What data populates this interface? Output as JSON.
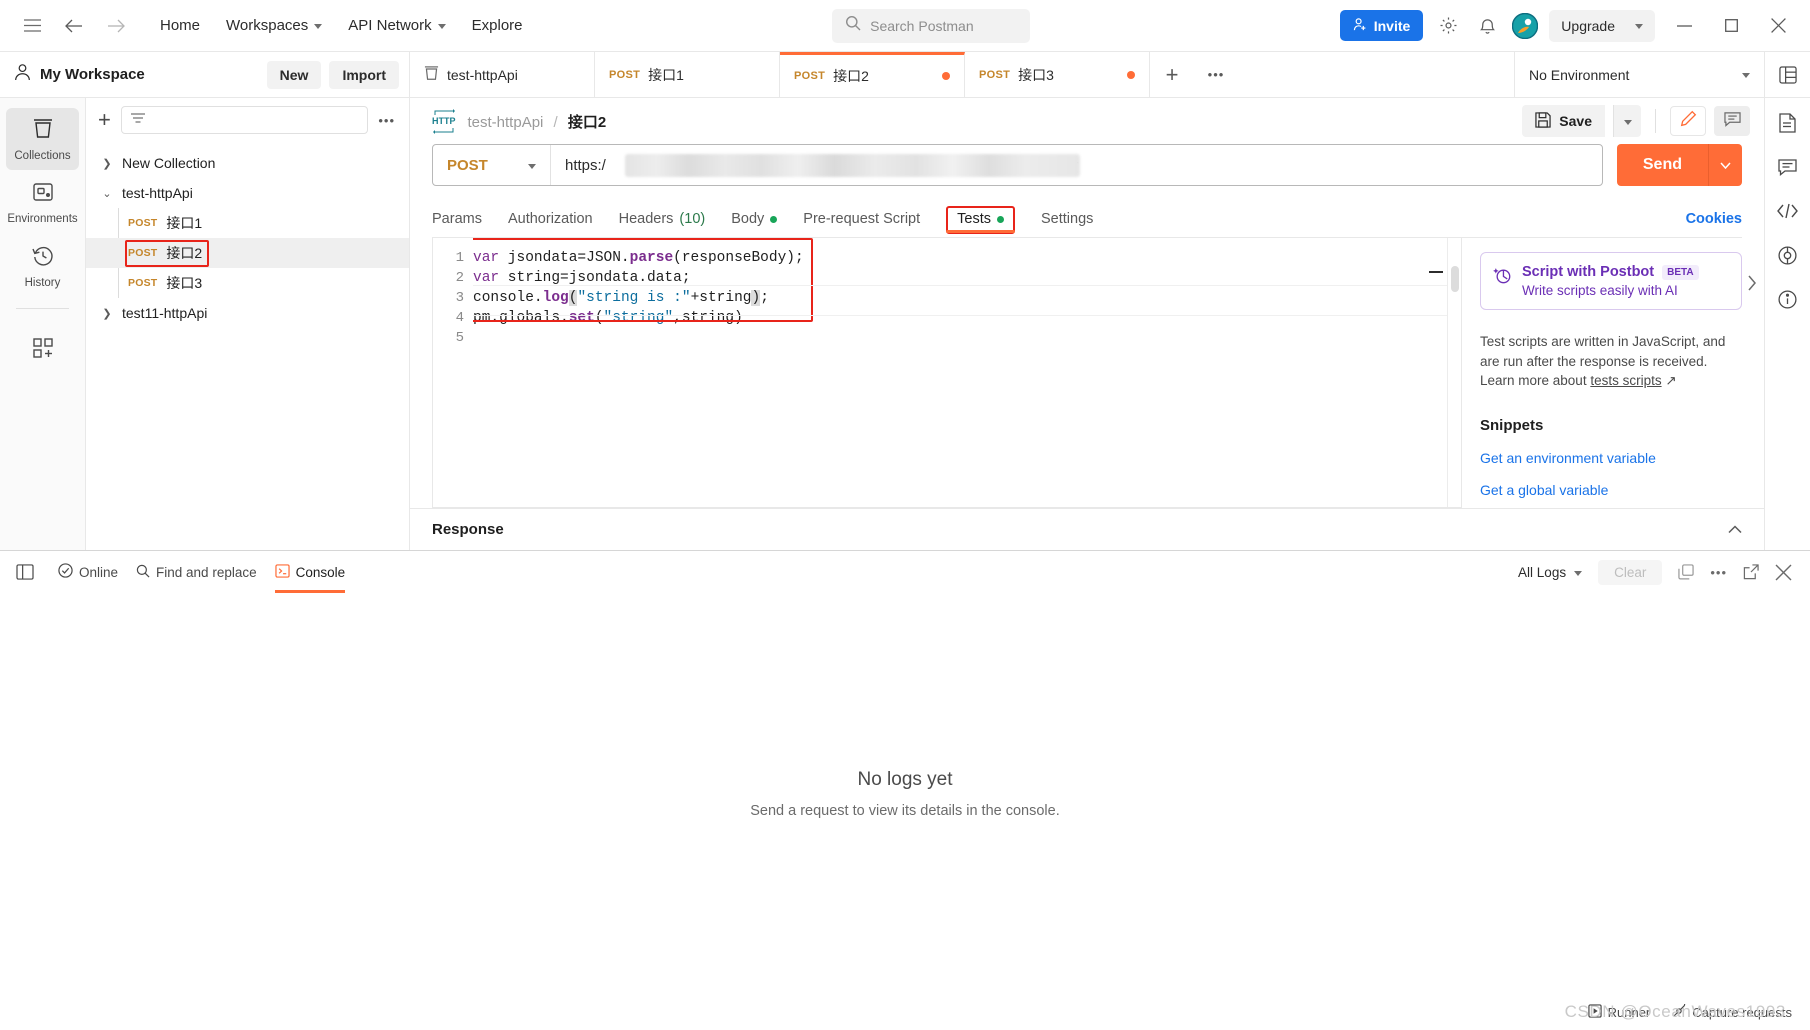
{
  "topbar": {
    "hamburger_icon": "hamburger-icon",
    "back_icon": "back-arrow-icon",
    "forward_icon": "forward-arrow-icon",
    "menu": [
      {
        "label": "Home",
        "caret": false
      },
      {
        "label": "Workspaces",
        "caret": true
      },
      {
        "label": "API Network",
        "caret": true
      },
      {
        "label": "Explore",
        "caret": false
      }
    ],
    "search_placeholder": "Search Postman",
    "invite_label": "Invite",
    "settings_icon": "gear-icon",
    "notifications_icon": "bell-icon",
    "account_icon": "postman-avatar-icon",
    "upgrade_label": "Upgrade",
    "minimize_icon": "minimize-icon",
    "maximize_icon": "maximize-icon",
    "close_icon": "close-icon"
  },
  "secondbar": {
    "workspace_name": "My Workspace",
    "new_label": "New",
    "import_label": "Import",
    "tabs": [
      {
        "verb": "",
        "name": "test-httpApi",
        "icon": "collection-icon",
        "active": false,
        "unsaved": false
      },
      {
        "verb": "POST",
        "name": "接口1",
        "active": false,
        "unsaved": false
      },
      {
        "verb": "POST",
        "name": "接口2",
        "active": true,
        "unsaved": true
      },
      {
        "verb": "POST",
        "name": "接口3",
        "active": false,
        "unsaved": true
      }
    ],
    "add_tab_icon": "plus-icon",
    "tab_more_icon": "more-horizontal-icon",
    "environment_label": "No Environment",
    "env_quick_icon": "environment-quick-look-icon"
  },
  "rail": {
    "items": [
      {
        "label": "Collections",
        "icon": "collections-icon",
        "active": true
      },
      {
        "label": "Environments",
        "icon": "environments-icon",
        "active": false
      },
      {
        "label": "History",
        "icon": "history-icon",
        "active": false
      }
    ],
    "bottom_icon": "add-apps-icon"
  },
  "collections": {
    "add_icon": "plus-icon",
    "filter_icon": "filter-icon",
    "filter_placeholder": "",
    "more_icon": "more-horizontal-icon",
    "tree": [
      {
        "type": "collection",
        "label": "New Collection",
        "expanded": false
      },
      {
        "type": "collection",
        "label": "test-httpApi",
        "expanded": true
      },
      {
        "type": "request",
        "verb": "POST",
        "label": "接口1",
        "selected": false,
        "annotated": false
      },
      {
        "type": "request",
        "verb": "POST",
        "label": "接口2",
        "selected": true,
        "annotated": true
      },
      {
        "type": "request",
        "verb": "POST",
        "label": "接口3",
        "selected": false,
        "annotated": false
      },
      {
        "type": "collection",
        "label": "test11-httpApi",
        "expanded": false
      }
    ]
  },
  "request": {
    "protocol_badge": "HTTP",
    "breadcrumb_collection": "test-httpApi",
    "breadcrumb_separator": "/",
    "breadcrumb_name": "接口2",
    "save_label": "Save",
    "save_icon": "save-disk-icon",
    "save_caret_icon": "chevron-down-icon",
    "edit_icon": "pencil-icon",
    "comment_icon": "comment-icon",
    "method": "POST",
    "method_caret_icon": "chevron-down-icon",
    "url_prefix": "https:/",
    "url_suffix": "tor",
    "url_redacted": true,
    "send_label": "Send",
    "send_caret_icon": "chevron-down-icon",
    "tabs": [
      {
        "label": "Params",
        "active": false,
        "badge": "",
        "dot": "",
        "boxed": false
      },
      {
        "label": "Authorization",
        "active": false,
        "badge": "",
        "dot": "",
        "boxed": false
      },
      {
        "label": "Headers",
        "active": false,
        "badge": "(10)",
        "dot": "",
        "boxed": false
      },
      {
        "label": "Body",
        "active": false,
        "badge": "",
        "dot": "green",
        "boxed": false
      },
      {
        "label": "Pre-request Script",
        "active": false,
        "badge": "",
        "dot": "",
        "boxed": false
      },
      {
        "label": "Tests",
        "active": true,
        "badge": "",
        "dot": "green",
        "boxed": true
      },
      {
        "label": "Settings",
        "active": false,
        "badge": "",
        "dot": "",
        "boxed": false
      }
    ],
    "cookies_label": "Cookies"
  },
  "editor": {
    "line_numbers": [
      "1",
      "2",
      "3",
      "4",
      "5"
    ],
    "code_lines": [
      "var jsondata=JSON.parse(responseBody);",
      "var string=jsondata.data;",
      "console.log(\"string is :\"+string);",
      "pm.globals.set(\"string\",string)",
      ""
    ]
  },
  "sidepanel": {
    "postbot_title": "Script with Postbot",
    "postbot_badge": "BETA",
    "postbot_sub": "Write scripts easily with AI",
    "postbot_icon": "postbot-icon",
    "expand_icon": "chevron-right-icon",
    "description_1": "Test scripts are written in JavaScript, and",
    "description_2": "are run after the response is received.",
    "description_3_prefix": "Learn more about ",
    "description_3_link": "tests scripts",
    "external_icon": "external-link-icon",
    "snippets_heading": "Snippets",
    "snippets": [
      "Get an environment variable",
      "Get a global variable"
    ]
  },
  "response": {
    "label": "Response",
    "collapse_icon": "chevron-up-icon"
  },
  "rightrail": {
    "items": [
      "documentation-icon",
      "comments-icon",
      "code-snippet-icon",
      "info-circle-icon",
      "help-circle-icon"
    ]
  },
  "console": {
    "layout_icon": "layout-icon",
    "online_label": "Online",
    "online_icon": "check-circle-icon",
    "find_replace_label": "Find and replace",
    "find_replace_icon": "search-icon",
    "console_label": "Console",
    "console_icon": "terminal-icon",
    "all_logs_label": "All Logs",
    "all_logs_caret": "chevron-down-icon",
    "clear_label": "Clear",
    "copy_icon": "copy-icon",
    "more_icon": "more-horizontal-icon",
    "popout_icon": "popout-icon",
    "close_icon": "close-icon",
    "empty_title": "No logs yet",
    "empty_sub": "Send a request to view its details in the console."
  },
  "statusbar": {
    "runner_label": "Runner",
    "runner_icon": "runner-icon",
    "capture_label": "Capture requests",
    "capture_icon": "capture-icon",
    "watermark": "CSDN @OceanWaves1993"
  },
  "colors": {
    "accent_orange": "#ff6c37",
    "blue": "#1a73e8",
    "method_amber": "#c5862b",
    "annotation_red": "#e8241a",
    "postbot_purple": "#6b2fb5",
    "green_dot": "#18a558"
  }
}
